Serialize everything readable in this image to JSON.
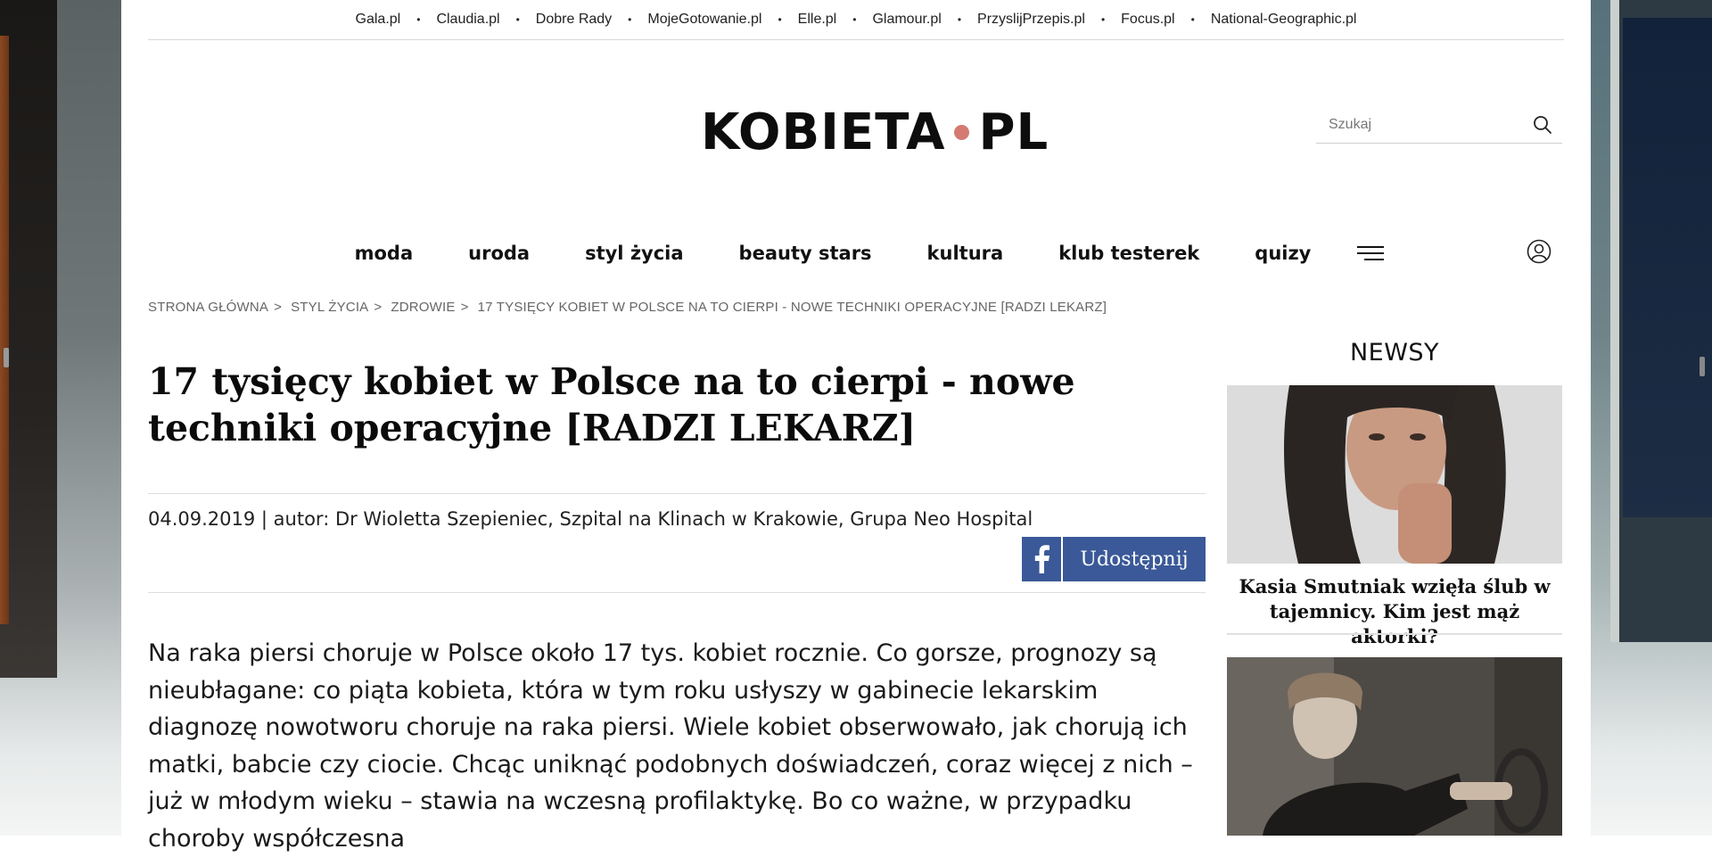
{
  "network_links": [
    "Gala.pl",
    "Claudia.pl",
    "Dobre Rady",
    "MojeGotowanie.pl",
    "Elle.pl",
    "Glamour.pl",
    "PrzyslijPrzepis.pl",
    "Focus.pl",
    "National-Geographic.pl"
  ],
  "network_separator": "•",
  "logo": {
    "left": "KOBIETA",
    "right": "PL",
    "dot_color": "#d47a72"
  },
  "search": {
    "placeholder": "Szukaj",
    "icon": "search-icon"
  },
  "nav": {
    "items": [
      "moda",
      "uroda",
      "styl życia",
      "beauty stars",
      "kultura",
      "klub testerek",
      "quizy"
    ],
    "menu_icon": "hamburger-icon",
    "user_icon": "user-icon"
  },
  "breadcrumb": [
    "STRONA GŁÓWNA",
    "STYL ŻYCIA",
    "ZDROWIE",
    "17 TYSIĘCY KOBIET W POLSCE NA TO CIERPI - NOWE TECHNIKI OPERACYJNE [RADZI LEKARZ]"
  ],
  "breadcrumb_separator": ">",
  "article": {
    "title": "17 tysięcy kobiet w Polsce na to cierpi - nowe techniki operacyjne [RADZI LEKARZ]",
    "meta": "04.09.2019 | autor: Dr Wioletta Szepieniec, Szpital na Klinach w Krakowie, Grupa Neo Hospital",
    "share_label": "Udostępnij",
    "share_color": "#3b5998",
    "body": "Na raka piersi choruje w Polsce około 17 tys. kobiet rocznie. Co gorsze, prognozy są nieubłagane: co piąta kobieta, która w tym roku usłyszy w gabinecie lekarskim diagnozę nowotworu choruje na raka piersi. Wiele kobiet obserwowało, jak chorują ich matki, babcie czy ciocie. Chcąc uniknąć podobnych doświadczeń, coraz więcej z nich – już w młodym wieku – stawia na wczesną profilaktykę. Bo co ważne, w przypadku choroby współczesna"
  },
  "sidebar": {
    "title": "NEWSY",
    "news": [
      {
        "title": "Kasia Smutniak wzięła ślub w tajemnicy. Kim jest mąż aktorki?"
      }
    ]
  }
}
